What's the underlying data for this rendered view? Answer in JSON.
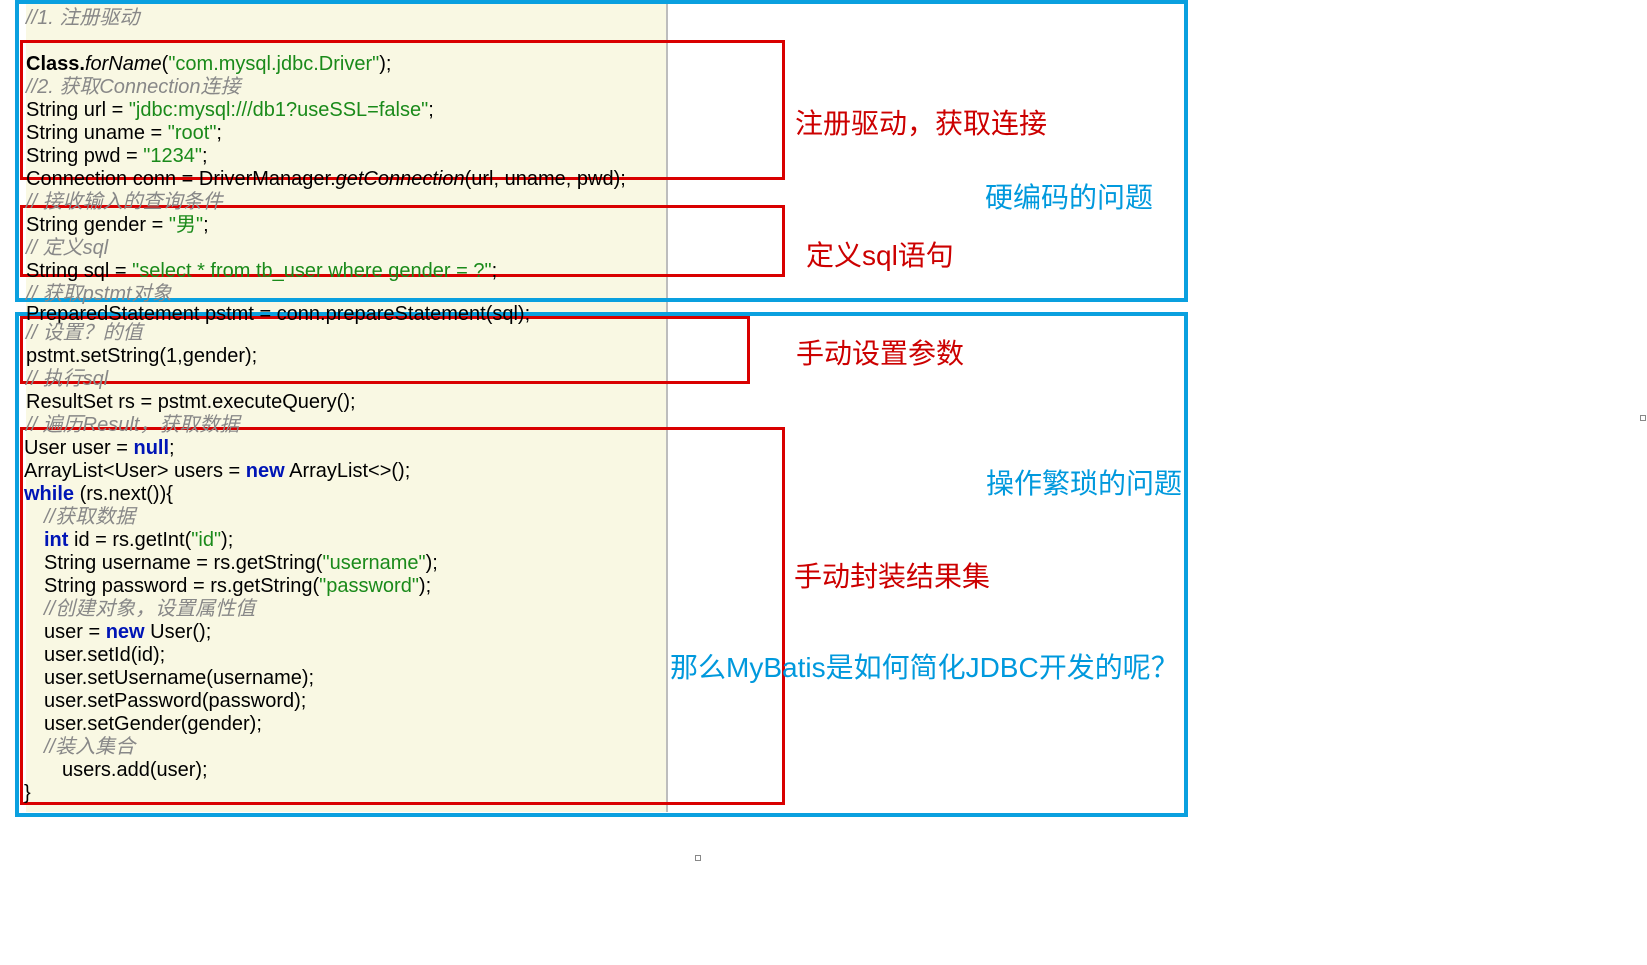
{
  "code": {
    "c1": "//1. 注册驱动",
    "c2_p1": "Class.",
    "c2_p2": "forName",
    "c2_p3": "(",
    "c2_str": "\"com.mysql.jdbc.Driver\"",
    "c2_p4": ");",
    "c3": "//2. 获取Connection连接",
    "c4_p1": "String url = ",
    "c4_str": "\"jdbc:mysql:///db1?useSSL=false\"",
    "c4_p2": ";",
    "c5_p1": "String uname = ",
    "c5_str": "\"root\"",
    "c5_p2": ";",
    "c6_p1": "String pwd = ",
    "c6_str": "\"1234\"",
    "c6_p2": ";",
    "c7_p1": "Connection conn = DriverManager.",
    "c7_m": "getConnection",
    "c7_p2": "(url, uname, pwd);",
    "c8": "// 接收输入的查询条件",
    "c9_p1": "String gender = ",
    "c9_str": "\"男\"",
    "c9_p2": ";",
    "c10": "// 定义sql",
    "c11_p1": "String sql = ",
    "c11_str": "\"select * from tb_user where gender = ?\"",
    "c11_p2": ";",
    "c12": "// 获取pstmt对象",
    "c13": "PreparedStatement pstmt = conn.prepareStatement(sql);",
    "c14": "// 设置？的值",
    "c15": "pstmt.setString(1,gender);",
    "c16": "// 执行sql",
    "c17": "ResultSet rs = pstmt.executeQuery();",
    "c18": "// 遍历Result，获取数据",
    "c19_p1": "User user = ",
    "c19_kw": "null",
    "c19_p2": ";",
    "c20_p1": "ArrayList<User> users = ",
    "c20_kw": "new",
    "c20_p2": " ArrayList<>();",
    "c21_kw": "while",
    "c21_p1": " (rs.next()){",
    "c22": "//获取数据",
    "c23_p1": "int",
    "c23_p2": " id = rs.getInt(",
    "c23_str": "\"id\"",
    "c23_p3": ");",
    "c24_p1": "String username = rs.getString(",
    "c24_str": "\"username\"",
    "c24_p2": ");",
    "c25_p1": "String password = rs.getString(",
    "c25_str": "\"password\"",
    "c25_p2": ");",
    "c26": "//创建对象，设置属性值",
    "c27_p1": "user = ",
    "c27_kw": "new",
    "c27_p2": " User();",
    "c28": "user.setId(id);",
    "c29": "user.setUsername(username);",
    "c30": "user.setPassword(password);",
    "c31": "user.setGender(gender);",
    "c32": "//装入集合",
    "c33": "users.add(user);",
    "c34": "}"
  },
  "anno": {
    "a1": "注册驱动，获取连接",
    "a2": "硬编码的问题",
    "a3": "定义sql语句",
    "a4": "手动设置参数",
    "a5": "操作繁琐的问题",
    "a6": "手动封装结果集",
    "a7": "那么MyBatis是如何简化JDBC开发的呢？"
  }
}
